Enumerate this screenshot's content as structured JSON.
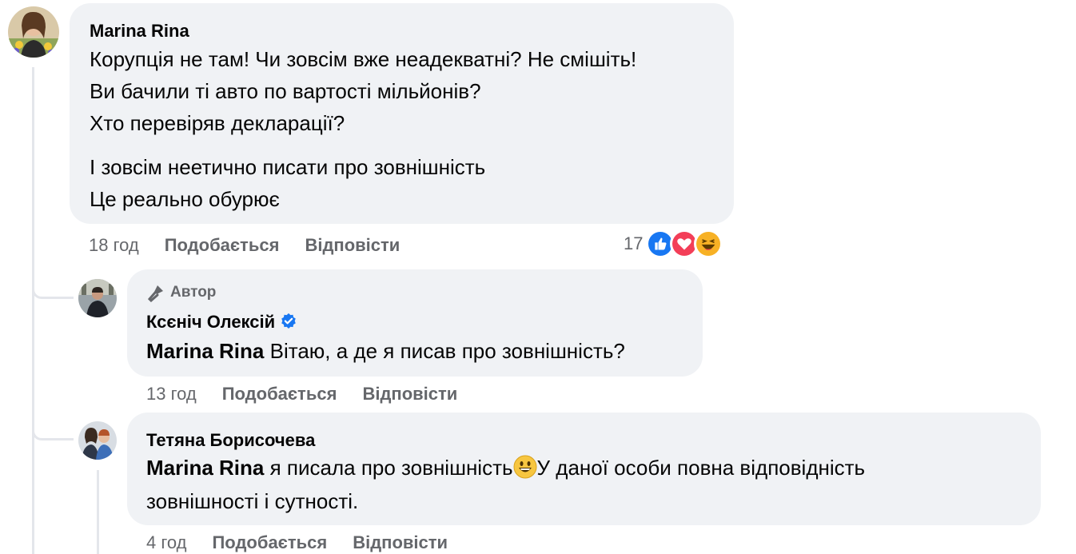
{
  "comments": [
    {
      "author": "Marina Rina",
      "lines": [
        "Корупція не там! Чи зовсім вже неадекватні? Не смішіть!",
        "Ви бачили ті авто по вартості мільйонів?",
        "Хто перевіряв декларації?",
        "І зовсім неетично писати про зовнішність",
        "Це реально обурює"
      ],
      "time": "18 год",
      "like_label": "Подобається",
      "reply_label": "Відповісти",
      "reaction_count": "17",
      "reactions": [
        "like-icon",
        "love-icon",
        "haha-icon"
      ]
    },
    {
      "badge": "Автор",
      "author": "Ксєніч Олексій",
      "verified": true,
      "mention": "Marina Rina",
      "text": "Вітаю, а де я писав про зовнішність?",
      "time": "13 год",
      "like_label": "Подобається",
      "reply_label": "Відповісти"
    },
    {
      "author": "Тетяна Борисочева",
      "mention": "Marina Rina",
      "text_before_emoji": "я писала про зовнішність",
      "emoji": "grinning-face-emoji",
      "text_after_emoji": "У даної особи повна відповідність",
      "text_line2": "зовнішності і сутності.",
      "time": "4 год",
      "like_label": "Подобається",
      "reply_label": "Відповісти"
    }
  ],
  "colors": {
    "bubble": "#f0f2f5",
    "secondary_text": "#65676b",
    "thread_line": "#e4e6eb",
    "verified": "#1877f2"
  }
}
